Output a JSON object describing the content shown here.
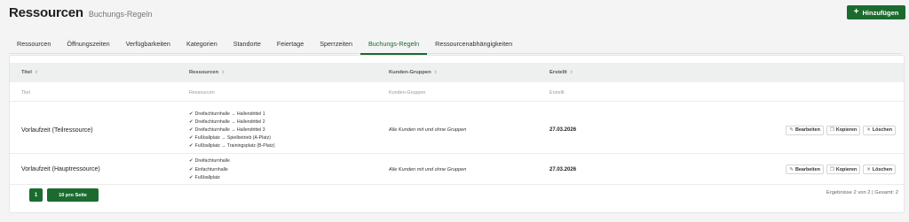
{
  "header": {
    "title": "Ressourcen",
    "subtitle": "Buchungs-Regeln",
    "add_button": "Hinzufügen"
  },
  "tabs": [
    {
      "label": "Ressourcen"
    },
    {
      "label": "Öffnungszeiten"
    },
    {
      "label": "Verfügbarkeiten"
    },
    {
      "label": "Kategorien"
    },
    {
      "label": "Standorte"
    },
    {
      "label": "Feiertage"
    },
    {
      "label": "Sperrzeiten"
    },
    {
      "label": "Buchungs-Regeln",
      "active": true
    },
    {
      "label": "Ressourcenabhängigkeiten"
    }
  ],
  "table": {
    "columns": {
      "title": "Titel",
      "resources": "Ressourcen",
      "groups": "Kunden-Gruppen",
      "created": "Erstellt"
    },
    "filters": {
      "title": "Titel",
      "resources": "Ressourcen",
      "groups": "Kunden-Gruppen",
      "created": "Erstellt"
    },
    "rows": [
      {
        "title": "Vorlaufzeit (Teilressource)",
        "resources": [
          "Dreifachturnhalle → Hallendrittel 1",
          "Dreifachturnhalle → Hallendrittel 2",
          "Dreifachturnhalle → Hallendrittel 3",
          "Fußballplatz → Spielbetrieb (A-Platz)",
          "Fußballplatz → Trainingsplatz (B-Platz)"
        ],
        "groups": "Alle Kunden mit und ohne Gruppen",
        "created": "27.03.2026"
      },
      {
        "title": "Vorlaufzeit (Hauptressource)",
        "resources": [
          "Dreifachturnhalle",
          "Einfachturnhalle",
          "Fußballplatz"
        ],
        "groups": "Alle Kunden mit und ohne Gruppen",
        "created": "27.03.2026"
      }
    ],
    "actions": {
      "edit": "Bearbeiten",
      "copy": "Kopieren",
      "delete": "Löschen"
    }
  },
  "pagination": {
    "page": "1",
    "per_page": "10 pro Seite",
    "result_info": "Ergebnisse 2 von 2 | Gesamt: 2"
  },
  "colors": {
    "accent": "#1b6b2f"
  }
}
